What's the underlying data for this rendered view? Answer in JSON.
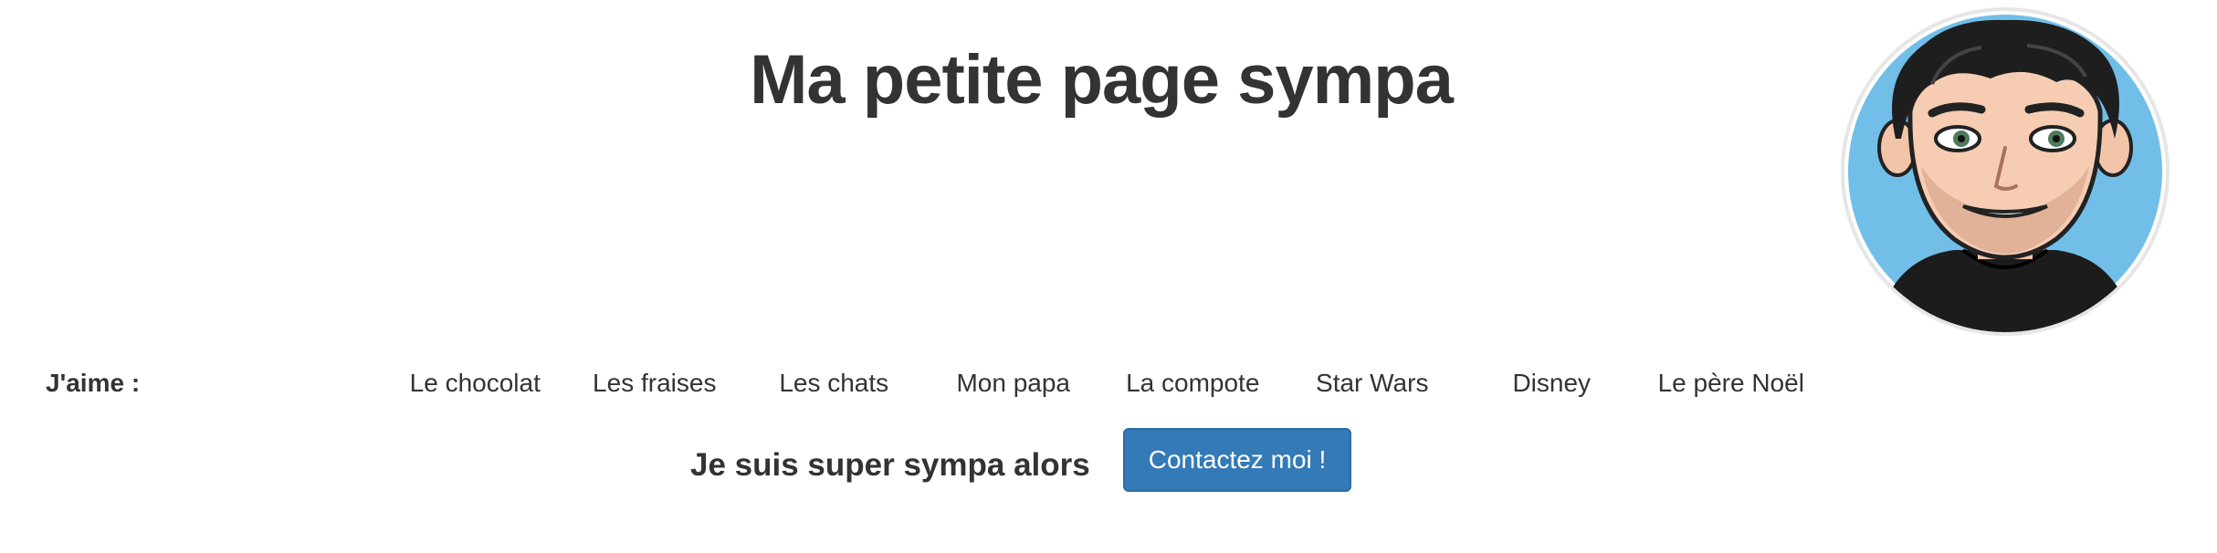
{
  "header": {
    "title": "Ma petite page sympa"
  },
  "avatar": {
    "icon": "cartoon-avatar",
    "background": "#71bfe8"
  },
  "likes": {
    "label": "J'aime :",
    "items": [
      "Le chocolat",
      "Les fraises",
      "Les chats",
      "Mon papa",
      "La compote",
      "Star Wars",
      "Disney",
      "Le père Noël"
    ]
  },
  "cta": {
    "text": "Je suis super sympa alors",
    "button_label": "Contactez moi !",
    "button_color": "#337ab7"
  }
}
